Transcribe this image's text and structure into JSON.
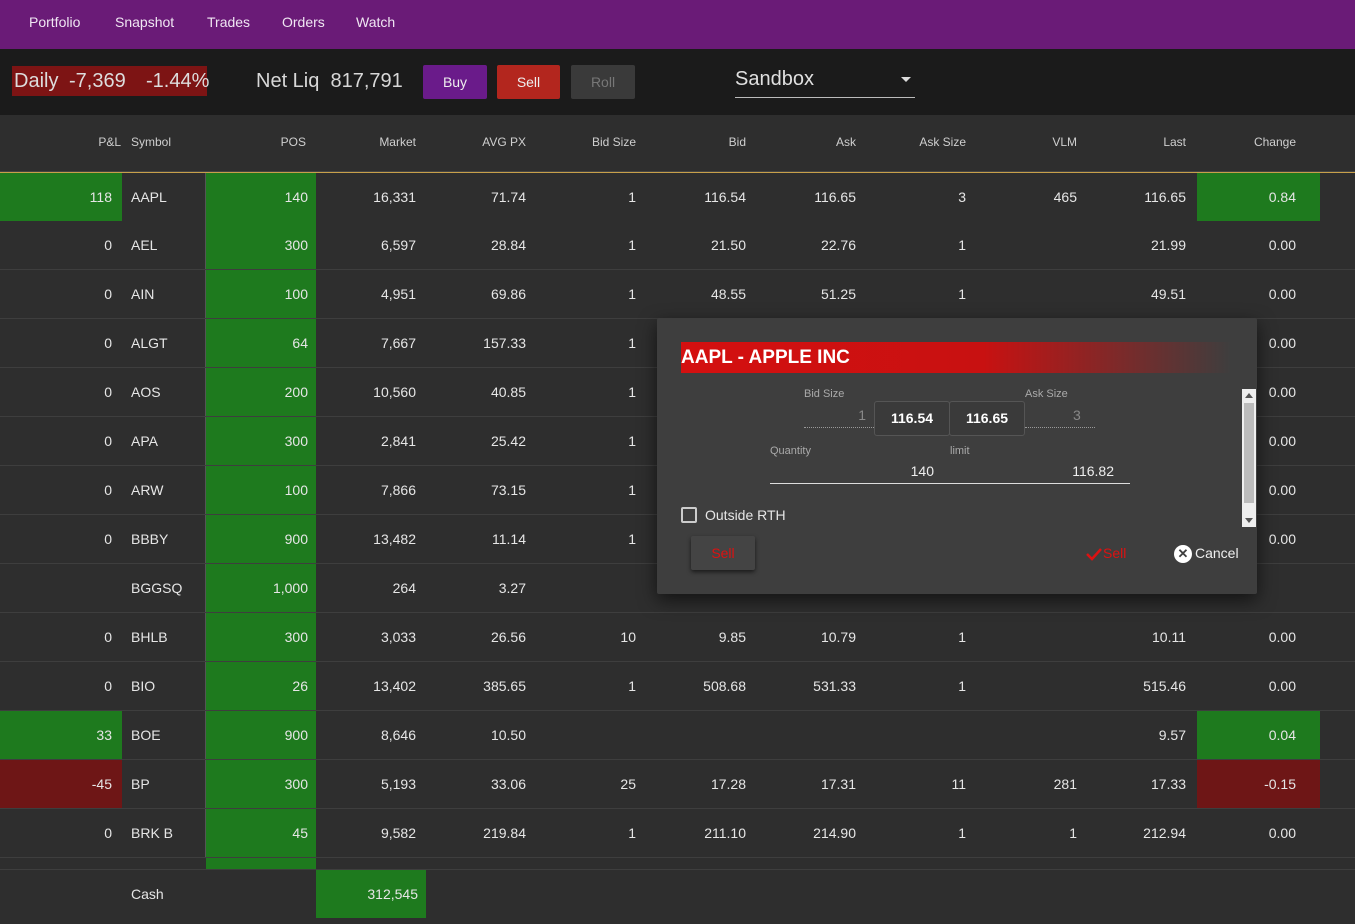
{
  "nav": {
    "items": [
      "Portfolio",
      "Snapshot",
      "Trades",
      "Orders",
      "Watch"
    ]
  },
  "summary": {
    "daily_label": "Daily",
    "daily_value": "-7,369",
    "daily_pct": "-1.44%",
    "netliq_label": "Net Liq",
    "netliq_value": "817,791",
    "buy_label": "Buy",
    "sell_label": "Sell",
    "roll_label": "Roll",
    "account": "Sandbox"
  },
  "table": {
    "headers": {
      "pnl": "P&L",
      "symbol": "Symbol",
      "pos": "POS",
      "market": "Market",
      "avgpx": "AVG PX",
      "bidsize": "Bid Size",
      "bid": "Bid",
      "ask": "Ask",
      "asksize": "Ask Size",
      "vlm": "VLM",
      "last": "Last",
      "change": "Change"
    },
    "rows": [
      {
        "pnl": "118",
        "symbol": "AAPL",
        "pos": "140",
        "market": "16,331",
        "avgpx": "71.74",
        "bidsize": "1",
        "bid": "116.54",
        "ask": "116.65",
        "asksize": "3",
        "vlm": "465",
        "last": "116.65",
        "change": "0.84"
      },
      {
        "pnl": "0",
        "symbol": "AEL",
        "pos": "300",
        "market": "6,597",
        "avgpx": "28.84",
        "bidsize": "1",
        "bid": "21.50",
        "ask": "22.76",
        "asksize": "1",
        "vlm": "",
        "last": "21.99",
        "change": "0.00"
      },
      {
        "pnl": "0",
        "symbol": "AIN",
        "pos": "100",
        "market": "4,951",
        "avgpx": "69.86",
        "bidsize": "1",
        "bid": "48.55",
        "ask": "51.25",
        "asksize": "1",
        "vlm": "",
        "last": "49.51",
        "change": "0.00"
      },
      {
        "pnl": "0",
        "symbol": "ALGT",
        "pos": "64",
        "market": "7,667",
        "avgpx": "157.33",
        "bidsize": "1",
        "bid": "",
        "ask": "",
        "asksize": "",
        "vlm": "",
        "last": "",
        "change": "0.00"
      },
      {
        "pnl": "0",
        "symbol": "AOS",
        "pos": "200",
        "market": "10,560",
        "avgpx": "40.85",
        "bidsize": "1",
        "bid": "",
        "ask": "",
        "asksize": "",
        "vlm": "",
        "last": "",
        "change": "0.00"
      },
      {
        "pnl": "0",
        "symbol": "APA",
        "pos": "300",
        "market": "2,841",
        "avgpx": "25.42",
        "bidsize": "1",
        "bid": "",
        "ask": "",
        "asksize": "",
        "vlm": "",
        "last": "",
        "change": "0.00"
      },
      {
        "pnl": "0",
        "symbol": "ARW",
        "pos": "100",
        "market": "7,866",
        "avgpx": "73.15",
        "bidsize": "1",
        "bid": "",
        "ask": "",
        "asksize": "",
        "vlm": "",
        "last": "",
        "change": "0.00"
      },
      {
        "pnl": "0",
        "symbol": "BBBY",
        "pos": "900",
        "market": "13,482",
        "avgpx": "11.14",
        "bidsize": "1",
        "bid": "",
        "ask": "",
        "asksize": "",
        "vlm": "",
        "last": "",
        "change": "0.00"
      },
      {
        "pnl": "",
        "symbol": "BGGSQ",
        "pos": "1,000",
        "market": "264",
        "avgpx": "3.27",
        "bidsize": "",
        "bid": "",
        "ask": "",
        "asksize": "",
        "vlm": "",
        "last": "",
        "change": ""
      },
      {
        "pnl": "0",
        "symbol": "BHLB",
        "pos": "300",
        "market": "3,033",
        "avgpx": "26.56",
        "bidsize": "10",
        "bid": "9.85",
        "ask": "10.79",
        "asksize": "1",
        "vlm": "",
        "last": "10.11",
        "change": "0.00"
      },
      {
        "pnl": "0",
        "symbol": "BIO",
        "pos": "26",
        "market": "13,402",
        "avgpx": "385.65",
        "bidsize": "1",
        "bid": "508.68",
        "ask": "531.33",
        "asksize": "1",
        "vlm": "",
        "last": "515.46",
        "change": "0.00"
      },
      {
        "pnl": "33",
        "symbol": "BOE",
        "pos": "900",
        "market": "8,646",
        "avgpx": "10.50",
        "bidsize": "",
        "bid": "",
        "ask": "",
        "asksize": "",
        "vlm": "",
        "last": "9.57",
        "change": "0.04"
      },
      {
        "pnl": "-45",
        "symbol": "BP",
        "pos": "300",
        "market": "5,193",
        "avgpx": "33.06",
        "bidsize": "25",
        "bid": "17.28",
        "ask": "17.31",
        "asksize": "11",
        "vlm": "281",
        "last": "17.33",
        "change": "-0.15"
      },
      {
        "pnl": "0",
        "symbol": "BRK B",
        "pos": "45",
        "market": "9,582",
        "avgpx": "219.84",
        "bidsize": "1",
        "bid": "211.10",
        "ask": "214.90",
        "asksize": "1",
        "vlm": "1",
        "last": "212.94",
        "change": "0.00"
      }
    ],
    "cash_label": "Cash",
    "cash_value": "312,545"
  },
  "dialog": {
    "title": "AAPL - APPLE INC",
    "bidsize_label": "Bid Size",
    "bidsize_value": "1",
    "asksize_label": "Ask Size",
    "asksize_value": "3",
    "bid_price": "116.54",
    "ask_price": "116.65",
    "quantity_label": "Quantity",
    "quantity_value": "140",
    "limit_label": "limit",
    "limit_value": "116.82",
    "outside_rth_label": "Outside RTH",
    "side_button_label": "Sell",
    "submit_label": "Sell",
    "cancel_label": "Cancel"
  },
  "colors": {
    "nav": "#6a1b77",
    "pos_green": "#1e7a1e",
    "loss_red": "#6e1616",
    "dialog_title": "#d41010",
    "accent_sell": "#dd1111"
  }
}
